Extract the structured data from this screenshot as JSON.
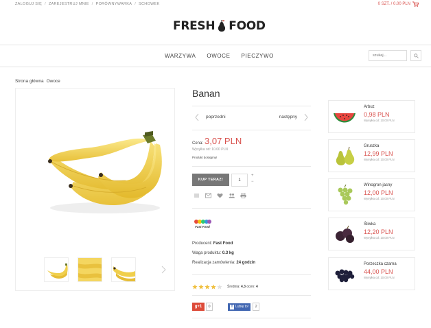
{
  "topbar": {
    "links": [
      "ZALOGUJ SIĘ",
      "ZAREJESTRUJ MNIE",
      "PORÓWNYWARKA",
      "SCHOWEK"
    ],
    "cart_text": "0 SZT. / 0.00 PLN",
    "accent": "#d9534f"
  },
  "logo": {
    "left": "FRESH",
    "right": "FOOD"
  },
  "nav": {
    "items": [
      "WARZYWA",
      "OWOCE",
      "PIECZYWO"
    ],
    "search_placeholder": "szukaj..."
  },
  "breadcrumb": [
    "Strona główna",
    "Owoce"
  ],
  "product": {
    "title": "Banan",
    "prev_label": "poprzedni",
    "next_label": "następny",
    "price_label": "Cena:",
    "price": "3,07 PLN",
    "shipping": "Wysyłka od: 10.00 PLN",
    "availability": "Produkt dostępny!",
    "buy_label": "KUP TERAZ!",
    "quantity": "1",
    "qty_plus": "+",
    "qty_minus": "−",
    "brand_logo_text": "Fast Food",
    "producer_label": "Producent:",
    "producer": "Fast Food",
    "weight_label": "Waga produktu:",
    "weight": "0.3 kg",
    "fulfillment_label": "Realizacja zamówienia:",
    "fulfillment": "24 godzin",
    "rating_value": 4.3,
    "rating_max": 5,
    "rating_avg_label": "Średnia:",
    "rating_avg": "4.3",
    "rating_count_label": "ocen:",
    "rating_count": "4",
    "gplus_label": "g+1",
    "gplus_count": "0",
    "fb_label": "Lubię to!",
    "fb_count": "2",
    "action_icons": [
      "compare-icon",
      "mail-icon",
      "heart-icon",
      "users-icon",
      "print-icon"
    ]
  },
  "sidebar": [
    {
      "name": "Arbuz",
      "price": "0,98 PLN",
      "shipping": "Wysyłka od: 10.00 PLN",
      "icon": "watermelon"
    },
    {
      "name": "Gruszka",
      "price": "12,99 PLN",
      "shipping": "Wysyłka od: 10.00 PLN",
      "icon": "pear"
    },
    {
      "name": "Winogron jasny",
      "price": "12,00 PLN",
      "shipping": "Wysyłka od: 10.00 PLN",
      "icon": "grapes-green"
    },
    {
      "name": "Śliwka",
      "price": "12,20 PLN",
      "shipping": "Wysyłka od: 10.00 PLN",
      "icon": "plum"
    },
    {
      "name": "Porzeczka czarna",
      "price": "44,00 PLN",
      "shipping": "Wysyłka od: 10.00 PLN",
      "icon": "blackcurrant"
    }
  ]
}
